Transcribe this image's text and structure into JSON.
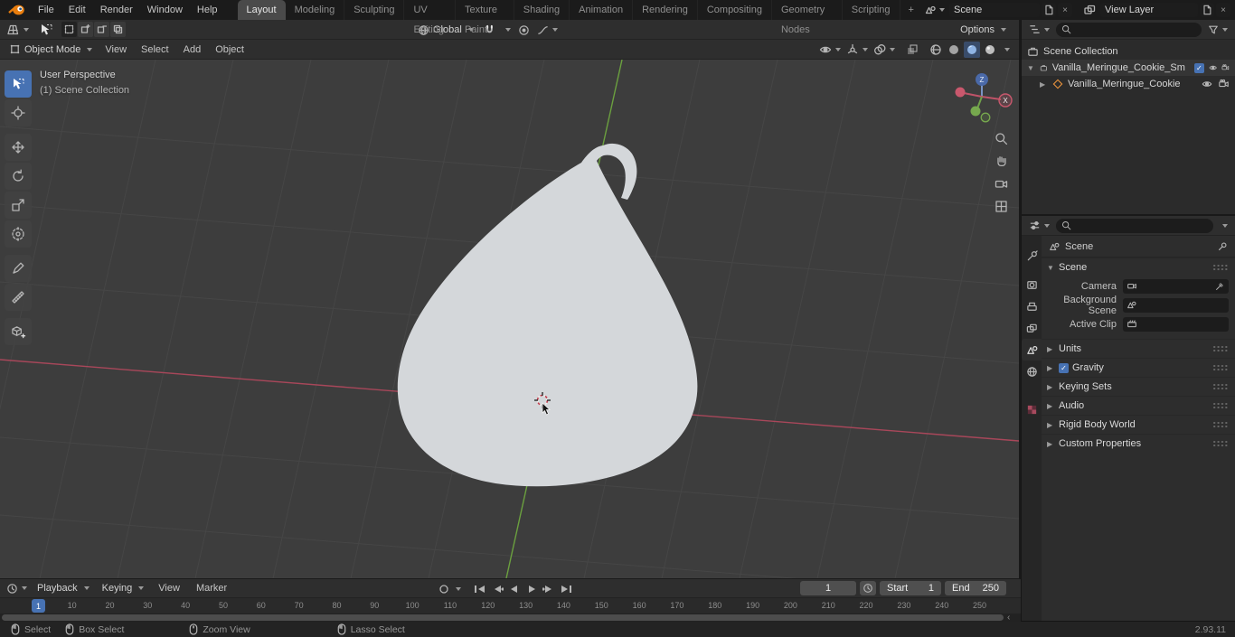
{
  "glyphs": {
    "tri_down": "▼",
    "tri_right": "▶",
    "close": "×",
    "check": "✓",
    "plus": "+",
    "chevron_left": "‹"
  },
  "colors": {
    "accent": "#4772b3",
    "axis_x_red": "#a8475a",
    "axis_y_green": "#6ba03f",
    "object_fill": "#d4d7da",
    "active_tab": "#4a4a4a"
  },
  "topbar": {
    "menus": [
      "File",
      "Edit",
      "Render",
      "Window",
      "Help"
    ],
    "workspaces": [
      "Layout",
      "Modeling",
      "Sculpting",
      "UV Editing",
      "Texture Paint",
      "Shading",
      "Animation",
      "Rendering",
      "Compositing",
      "Geometry Nodes",
      "Scripting"
    ],
    "active_workspace": "Layout",
    "scene": {
      "value": "Scene"
    },
    "view_layer": {
      "value": "View Layer"
    }
  },
  "tool_header": {
    "orientation_label": "Global",
    "options_label": "Options"
  },
  "mode_header": {
    "mode_label": "Object Mode",
    "menus": [
      "View",
      "Select",
      "Add",
      "Object"
    ]
  },
  "viewport": {
    "perspective_label": "User Perspective",
    "collection_label": "(1) Scene Collection",
    "gizmo": {
      "z_label": "Z",
      "x_label": "X"
    }
  },
  "outliner": {
    "root_label": "Scene Collection",
    "items": [
      {
        "label": "Vanilla_Meringue_Cookie_Sm"
      },
      {
        "label": "Vanilla_Meringue_Cookie"
      }
    ]
  },
  "properties": {
    "breadcrumb": "Scene",
    "section_scene_label": "Scene",
    "fields": [
      {
        "label": "Camera",
        "value": ""
      },
      {
        "label": "Background Scene",
        "value": ""
      },
      {
        "label": "Active Clip",
        "value": ""
      }
    ],
    "collapsed_sections": [
      "Units",
      "Gravity",
      "Keying Sets",
      "Audio",
      "Rigid Body World",
      "Custom Properties"
    ]
  },
  "timeline": {
    "menus": [
      "Playback",
      "Keying",
      "View",
      "Marker"
    ],
    "current_frame": "1",
    "start_label": "Start",
    "start_value": "1",
    "end_label": "End",
    "end_value": "250",
    "playhead_label": "1",
    "ruler_frames": [
      10,
      20,
      30,
      40,
      50,
      60,
      70,
      80,
      90,
      100,
      110,
      120,
      130,
      140,
      150,
      160,
      170,
      180,
      190,
      200,
      210,
      220,
      230,
      240,
      250
    ]
  },
  "statusbar": {
    "hints": [
      "Select",
      "Box Select",
      "Zoom View",
      "Lasso Select"
    ],
    "version": "2.93.11"
  },
  "icons": {
    "blender-logo": "orange orb with tail",
    "dropdown-arrow": "triangle-down",
    "search": "magnifier",
    "filter": "funnel",
    "eye": "visibility",
    "camera": "render visibility",
    "checkbox": "checked box",
    "collection": "box",
    "mesh-object": "orange cube",
    "magnet": "snapping",
    "globe": "transform orientation",
    "proportional": "concentric circles",
    "falloff": "curve",
    "pin": "pushpin",
    "eyedropper": "picker",
    "clock": "time",
    "printer": "output",
    "sliders": "properties",
    "wrench": "tool",
    "world": "globe",
    "texture": "red checker",
    "scene": "cone and sphere",
    "mouse": "mouse button hint"
  }
}
